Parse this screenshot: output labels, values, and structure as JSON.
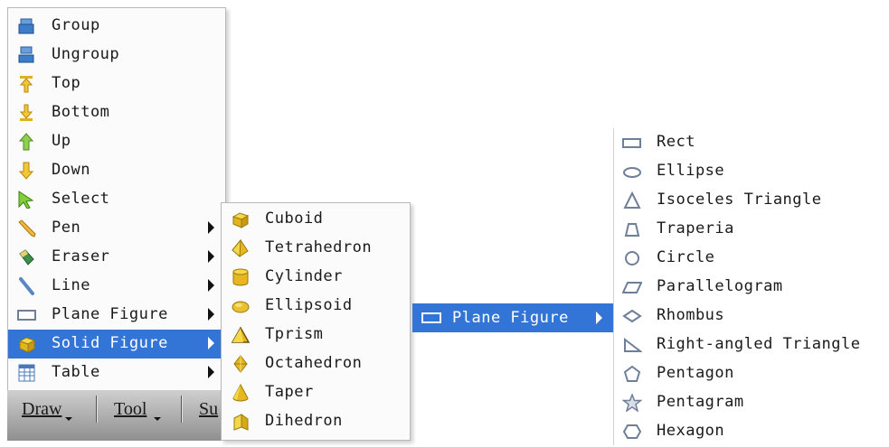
{
  "main_menu": {
    "items": [
      {
        "label": "Group",
        "icon": "group-icon"
      },
      {
        "label": "Ungroup",
        "icon": "ungroup-icon"
      },
      {
        "label": "Top",
        "icon": "top-icon"
      },
      {
        "label": "Bottom",
        "icon": "bottom-icon"
      },
      {
        "label": "Up",
        "icon": "up-arrow-icon"
      },
      {
        "label": "Down",
        "icon": "down-arrow-icon"
      },
      {
        "label": "Select",
        "icon": "select-cursor-icon"
      },
      {
        "label": "Pen",
        "icon": "pen-icon",
        "submenu": true
      },
      {
        "label": "Eraser",
        "icon": "eraser-icon",
        "submenu": true
      },
      {
        "label": "Line",
        "icon": "line-icon",
        "submenu": true
      },
      {
        "label": "Plane Figure",
        "icon": "plane-figure-icon",
        "submenu": true
      },
      {
        "label": "Solid Figure",
        "icon": "solid-figure-icon",
        "submenu": true,
        "selected": true
      },
      {
        "label": "Table",
        "icon": "table-icon",
        "submenu": true
      }
    ]
  },
  "solid_menu": {
    "items": [
      {
        "label": "Cuboid",
        "icon": "cuboid-icon"
      },
      {
        "label": "Tetrahedron",
        "icon": "tetrahedron-icon"
      },
      {
        "label": "Cylinder",
        "icon": "cylinder-icon"
      },
      {
        "label": "Ellipsoid",
        "icon": "ellipsoid-icon"
      },
      {
        "label": "Tprism",
        "icon": "tprism-icon"
      },
      {
        "label": "Octahedron",
        "icon": "octahedron-icon"
      },
      {
        "label": "Taper",
        "icon": "taper-icon"
      },
      {
        "label": "Dihedron",
        "icon": "dihedron-icon"
      }
    ]
  },
  "plane_strip": {
    "label": "Plane Figure",
    "icon": "plane-figure-icon"
  },
  "plane_menu": {
    "items": [
      {
        "label": "Rect",
        "icon": "rect-icon"
      },
      {
        "label": "Ellipse",
        "icon": "ellipse-icon"
      },
      {
        "label": "Isoceles Triangle",
        "icon": "isoceles-triangle-icon"
      },
      {
        "label": "Traperia",
        "icon": "trapezoid-icon"
      },
      {
        "label": "Circle",
        "icon": "circle-icon"
      },
      {
        "label": "Parallelogram",
        "icon": "parallelogram-icon"
      },
      {
        "label": "Rhombus",
        "icon": "rhombus-icon"
      },
      {
        "label": "Right-angled Triangle",
        "icon": "right-triangle-icon"
      },
      {
        "label": "Pentagon",
        "icon": "pentagon-icon"
      },
      {
        "label": "Pentagram",
        "icon": "pentagram-icon"
      },
      {
        "label": "Hexagon",
        "icon": "hexagon-icon"
      }
    ]
  },
  "toolbar": {
    "draw_label": "Draw",
    "tool_label": "Tool",
    "partial_label": "Su"
  },
  "colors": {
    "selection": "#3375d6",
    "menu_bg": "#fbfbfb",
    "shape_icon": "#8a9bb8",
    "solid_icon": "#e3b91c"
  }
}
